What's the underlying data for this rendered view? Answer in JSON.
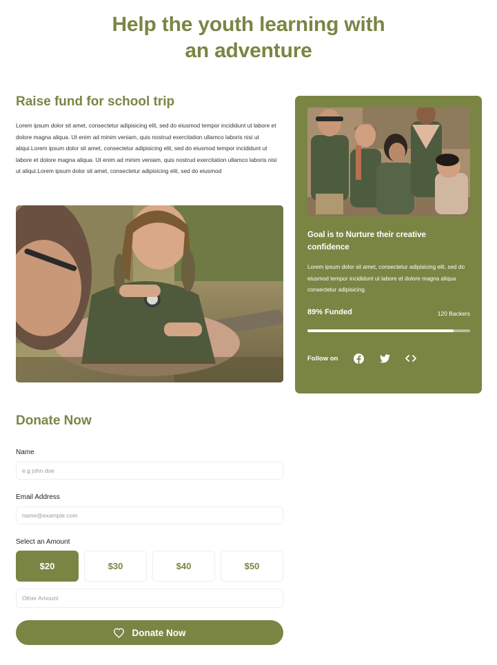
{
  "hero": {
    "title_line1": "Help the youth learning with",
    "title_line2": "an adventure"
  },
  "fundraiser": {
    "title": "Raise fund for school trip",
    "description": "Lorem ipsum dolor sit amet, consectetur adipisicing elit, sed do eiusmod tempor incididunt ut labore et dolore magna aliqua. Ut enim ad minim veniam, quis nostrud exercitation ullamco laboris nisi ut aliqui.Lorem ipsum dolor sit amet, consectetur adipisicing elit, sed do eiusmod tempor incididunt ut labore et dolore magna aliqua. Ut enim ad minim veniam, quis nostrud exercitation ullamco laboris nisi ut aliqui.Lorem ipsum dolor sit amet, consectetur adipisicing elit, sed do eiusmod"
  },
  "card": {
    "title": "Goal is to Nurture their creative confidence",
    "description": "Lorem ipsum dolor sit amet, consectetur adipisicing elit, sed do eiusmod tempor incididunt ut labore et dolore magna aliqua consectetur adipisicing.",
    "funded_label": "89% Funded",
    "funded_fraction": 0.9,
    "backers_label": "120 Backers",
    "follow_label": "Follow on",
    "social_icons": [
      "facebook-icon",
      "twitter-icon",
      "code-icon"
    ]
  },
  "donate": {
    "title": "Donate Now",
    "name_label": "Name",
    "name_placeholder": "e.g john doe",
    "email_label": "Email Address",
    "email_placeholder": "name@example.com",
    "amount_label": "Select an Amount",
    "amounts": [
      "$20",
      "$30",
      "$40",
      "$50"
    ],
    "selected_amount": "$20",
    "other_placeholder": "Other Amount",
    "submit_label": "Donate Now",
    "submit_icon": "heart-icon"
  },
  "colors": {
    "accent": "#7a8544",
    "white": "#ffffff"
  }
}
